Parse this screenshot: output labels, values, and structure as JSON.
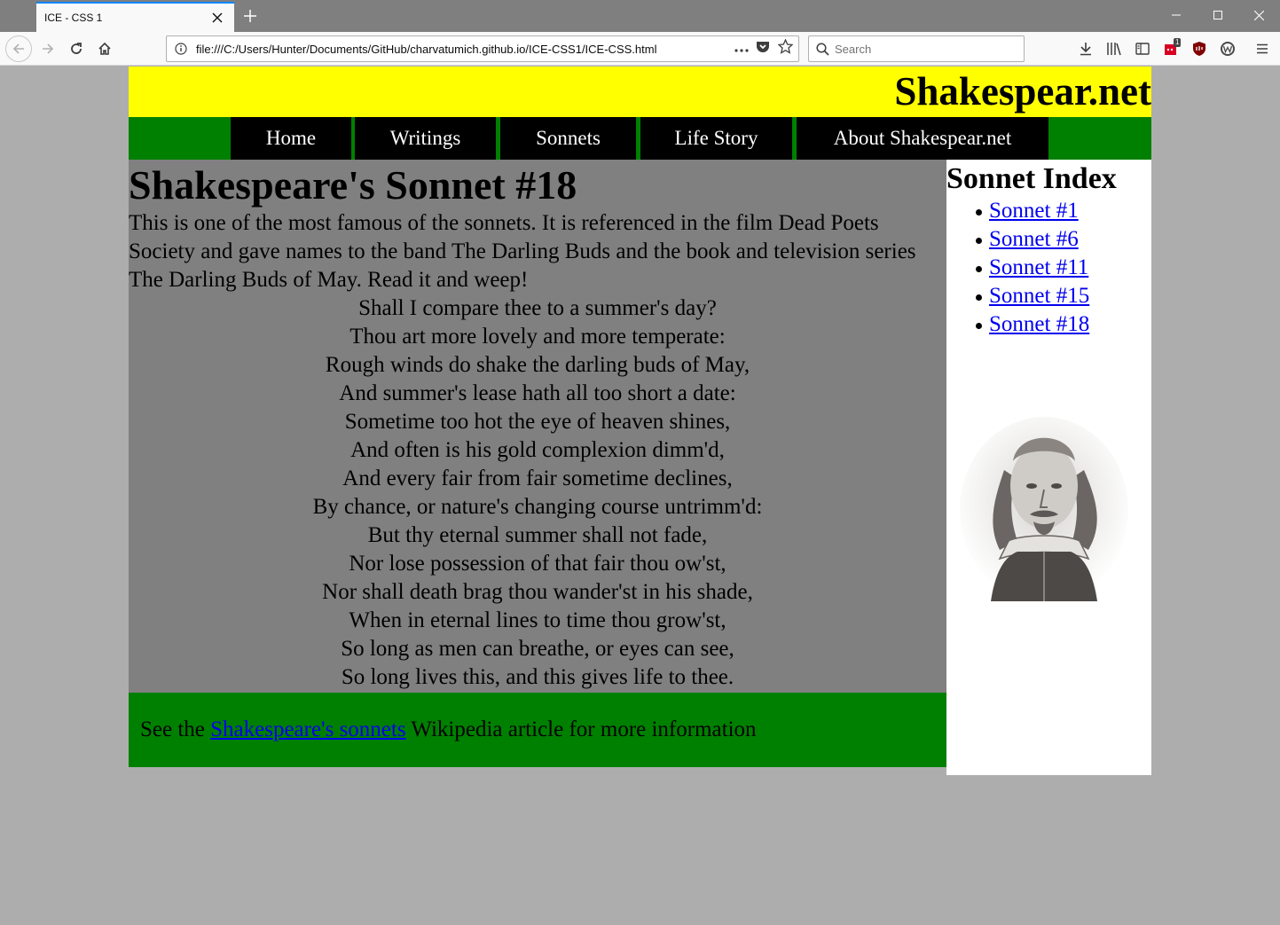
{
  "browser": {
    "tab_title": "ICE - CSS 1",
    "url": "file:///C:/Users/Hunter/Documents/GitHub/charvatumich.github.io/ICE-CSS1/ICE-CSS.html",
    "search_placeholder": "Search",
    "extension_badge": "1",
    "accent_color": "#0a84ff"
  },
  "site": {
    "title": "Shakespear.net",
    "header_color": "#ffff00",
    "nav_color": "#008000",
    "main_color": "#808080"
  },
  "menu": {
    "items": [
      {
        "label": "Home"
      },
      {
        "label": "Writings"
      },
      {
        "label": "Sonnets"
      },
      {
        "label": "Life Story"
      },
      {
        "label": "About Shakespear.net"
      }
    ]
  },
  "main": {
    "heading": "Shakespeare's Sonnet #18",
    "intro": "This is one of the most famous of the sonnets. It is referenced in the film Dead Poets Society and gave names to the band The Darling Buds and the book and television series The Darling Buds of May. Read it and weep!",
    "poem": [
      "Shall I compare thee to a summer's day?",
      "Thou art more lovely and more temperate:",
      "Rough winds do shake the darling buds of May,",
      "And summer's lease hath all too short a date:",
      "Sometime too hot the eye of heaven shines,",
      "And often is his gold complexion dimm'd,",
      "And every fair from fair sometime declines,",
      "By chance, or nature's changing course untrimm'd:",
      "But thy eternal summer shall not fade,",
      "Nor lose possession of that fair thou ow'st,",
      "Nor shall death brag thou wander'st in his shade,",
      "When in eternal lines to time thou grow'st,",
      "So long as men can breathe, or eyes can see,",
      "So long lives this, and this gives life to thee."
    ]
  },
  "footer": {
    "prefix": "See the",
    "link": "Shakespeare's sonnets",
    "suffix": "Wikipedia article for more information"
  },
  "aside": {
    "heading": "Sonnet Index",
    "links": [
      {
        "label": "Sonnet #1"
      },
      {
        "label": "Sonnet #6"
      },
      {
        "label": "Sonnet #11"
      },
      {
        "label": "Sonnet #15"
      },
      {
        "label": "Sonnet #18"
      }
    ]
  }
}
